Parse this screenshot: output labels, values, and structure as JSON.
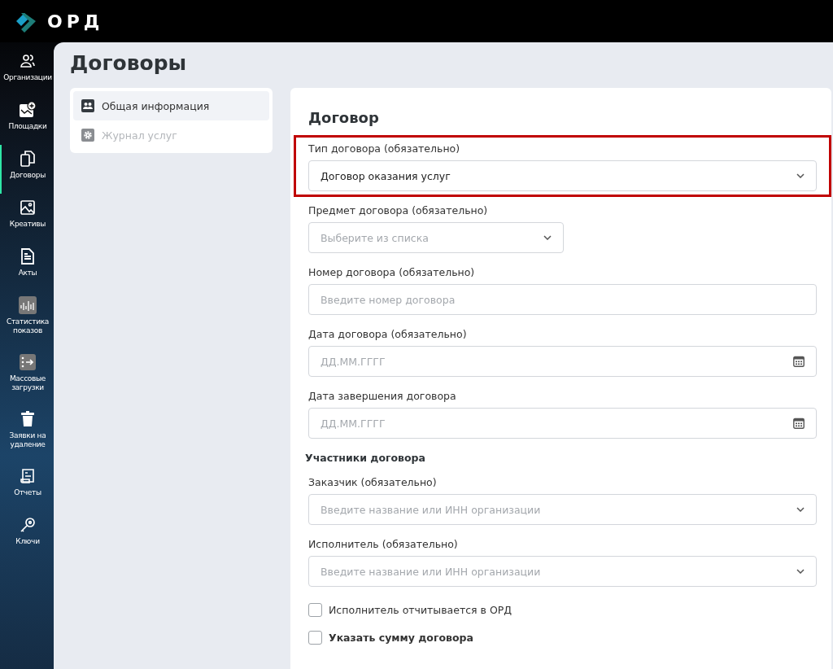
{
  "app": {
    "logo_text": "ОРД"
  },
  "sidebar": {
    "items": [
      {
        "label": "Организации",
        "selected": false
      },
      {
        "label": "Площадки",
        "selected": false
      },
      {
        "label": "Договоры",
        "selected": true
      },
      {
        "label": "Креативы",
        "selected": false
      },
      {
        "label": "Акты",
        "selected": false
      },
      {
        "label": "Статистика показов",
        "selected": false
      },
      {
        "label": "Массовые загрузки",
        "selected": false
      },
      {
        "label": "Заявки на удаление",
        "selected": false
      },
      {
        "label": "Отчеты",
        "selected": false
      },
      {
        "label": "Ключи",
        "selected": false
      }
    ]
  },
  "page": {
    "title": "Договоры"
  },
  "sections_nav": {
    "items": [
      {
        "label": "Общая информация",
        "selected": true,
        "disabled": false
      },
      {
        "label": "Журнал услуг",
        "selected": false,
        "disabled": true
      }
    ]
  },
  "form": {
    "title": "Договор",
    "fields": [
      {
        "kind": "select",
        "label": "Тип договора (обязательно)",
        "value": "Договор оказания услуг",
        "highlighted": true
      },
      {
        "kind": "dropdown",
        "label": "Предмет договора (обязательно)",
        "placeholder": "Выберите из списка",
        "highlighted": false
      },
      {
        "kind": "input",
        "label": "Номер договора (обязательно)",
        "placeholder": "Введите номер договора",
        "highlighted": false
      },
      {
        "kind": "date",
        "label": "Дата договора (обязательно)",
        "placeholder": "ДД.ММ.ГГГГ",
        "highlighted": false
      },
      {
        "kind": "date",
        "label": "Дата завершения договора",
        "placeholder": "ДД.ММ.ГГГГ",
        "highlighted": false
      }
    ],
    "participants_title": "Участники договора",
    "participants": [
      {
        "kind": "select",
        "label": "Заказчик (обязательно)",
        "placeholder": "Введите название или ИНН организации",
        "highlighted": false
      },
      {
        "kind": "select",
        "label": "Исполнитель (обязательно)",
        "placeholder": "Введите название или ИНН организации",
        "highlighted": false
      }
    ],
    "checkboxes": [
      {
        "label": "Исполнитель отчитывается в ОРД",
        "checked": false,
        "bold": false
      },
      {
        "label": "Указать сумму договора",
        "checked": false,
        "bold": true
      }
    ]
  }
}
